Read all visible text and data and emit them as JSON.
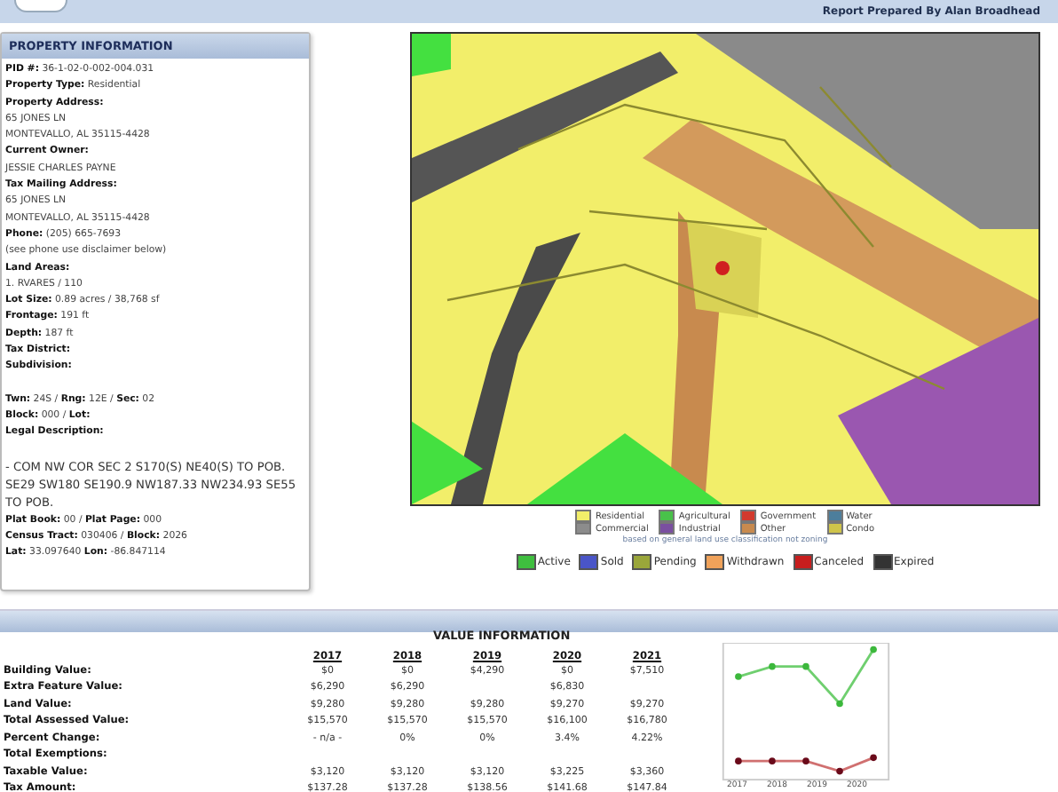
{
  "header": {
    "prepared_by": "Report Prepared By Alan Broadhead"
  },
  "property": {
    "title": "PROPERTY INFORMATION",
    "blocks": [
      [
        "**PID #:** 36-1-02-0-002-004.031",
        "**Property Type:** Residential",
        "**Property Address:**",
        "65 JONES LN",
        "MONTEVALLO, AL 35115-4428",
        "**Current Owner:**",
        "JESSIE CHARLES PAYNE",
        "**Tax Mailing Address:**",
        "65 JONES LN",
        "MONTEVALLO, AL 35115-4428",
        "**Phone:** (205) 665-7693",
        "(see phone use disclaimer below)",
        "**Land Areas:**",
        "1. RVARES / 110",
        "**Lot Size:** 0.89 acres / 38,768 sf",
        "**Frontage:** 191 ft",
        "**Depth:** 187 ft",
        "**Tax District:**",
        "**Subdivision:**"
      ],
      [
        "**Twn:** 24S / **Rng:** 12E / **Sec:** 02",
        "**Block:** 000 / **Lot:**",
        "**Legal Description:**"
      ]
    ],
    "legal": "- COM NW COR SEC 2 S170(S) NE40(S) TO POB. SE29 SW180 SE190.9 NW187.33 NW234.93 SE55 TO POB.",
    "footer_lines": [
      "**Plat Book:** 00 / **Plat Page:** 000",
      "**Census Tract:** 030406 / **Block:** 2026",
      "**Lat:** 33.097640 **Lon:** -86.847114"
    ]
  },
  "map": {
    "kind": "picture",
    "land_use_legend": [
      {
        "label": "Residential",
        "color": "#f2ee6a"
      },
      {
        "label": "Agricultural",
        "color": "#49c14a"
      },
      {
        "label": "Government",
        "color": "#d23a2e"
      },
      {
        "label": "Water",
        "color": "#4d7e9c"
      },
      {
        "label": "Commercial",
        "color": "#8c8c8c"
      },
      {
        "label": "Industrial",
        "color": "#7a4fa0"
      },
      {
        "label": "Other",
        "color": "#c88a4e"
      },
      {
        "label": "Condo",
        "color": "#cfc44a"
      }
    ],
    "note": "based on general land use classification not zoning",
    "status_legend": [
      {
        "label": "Active",
        "color": "#3fbf3f"
      },
      {
        "label": "Sold",
        "color": "#4a55c8"
      },
      {
        "label": "Pending",
        "color": "#9aa63a"
      },
      {
        "label": "Withdrawn",
        "color": "#f0a25a"
      },
      {
        "label": "Canceled",
        "color": "#c81e1e"
      },
      {
        "label": "Expired",
        "color": "#333333"
      }
    ]
  },
  "values": {
    "title": "VALUE INFORMATION",
    "years": [
      "2017",
      "2018",
      "2019",
      "2020",
      "2021"
    ],
    "rows": [
      {
        "label": "Building Value:",
        "values": {
          "2017": "$0",
          "2018": "$0",
          "2019": "$4,290",
          "2020": "$0",
          "2021": "$7,510"
        }
      },
      {
        "label": "Extra Feature Value:",
        "values": {
          "2017": "$6,290",
          "2018": "$6,290",
          "2020": "$6,830"
        }
      },
      {
        "label": "Land Value:",
        "values": {
          "2017": "$9,280",
          "2018": "$9,280",
          "2019": "$9,280",
          "2020": "$9,270",
          "2021": "$9,270"
        }
      },
      {
        "label": "Total Assessed Value:",
        "values": {
          "2017": "$15,570",
          "2018": "$15,570",
          "2019": "$15,570",
          "2020": "$16,100",
          "2021": "$16,780"
        }
      },
      {
        "label": "Percent Change:",
        "values": {
          "2017": "- n/a -",
          "2018": "0%",
          "2019": "0%",
          "2020": "3.4%",
          "2021": "4.22%"
        }
      },
      {
        "label": "Total Exemptions:"
      },
      {
        "label": "Taxable Value:",
        "values": {
          "2017": "$3,120",
          "2018": "$3,120",
          "2019": "$3,120",
          "2020": "$3,225",
          "2021": "$3,360"
        }
      },
      {
        "label": "Tax Amount:",
        "values": {
          "2017": "$137.28",
          "2018": "$137.28",
          "2019": "$138.56",
          "2020": "$141.68",
          "2021": "$147.84"
        }
      }
    ],
    "chart_x_labels": [
      "2017",
      "2018",
      "2019",
      "2020"
    ]
  }
}
